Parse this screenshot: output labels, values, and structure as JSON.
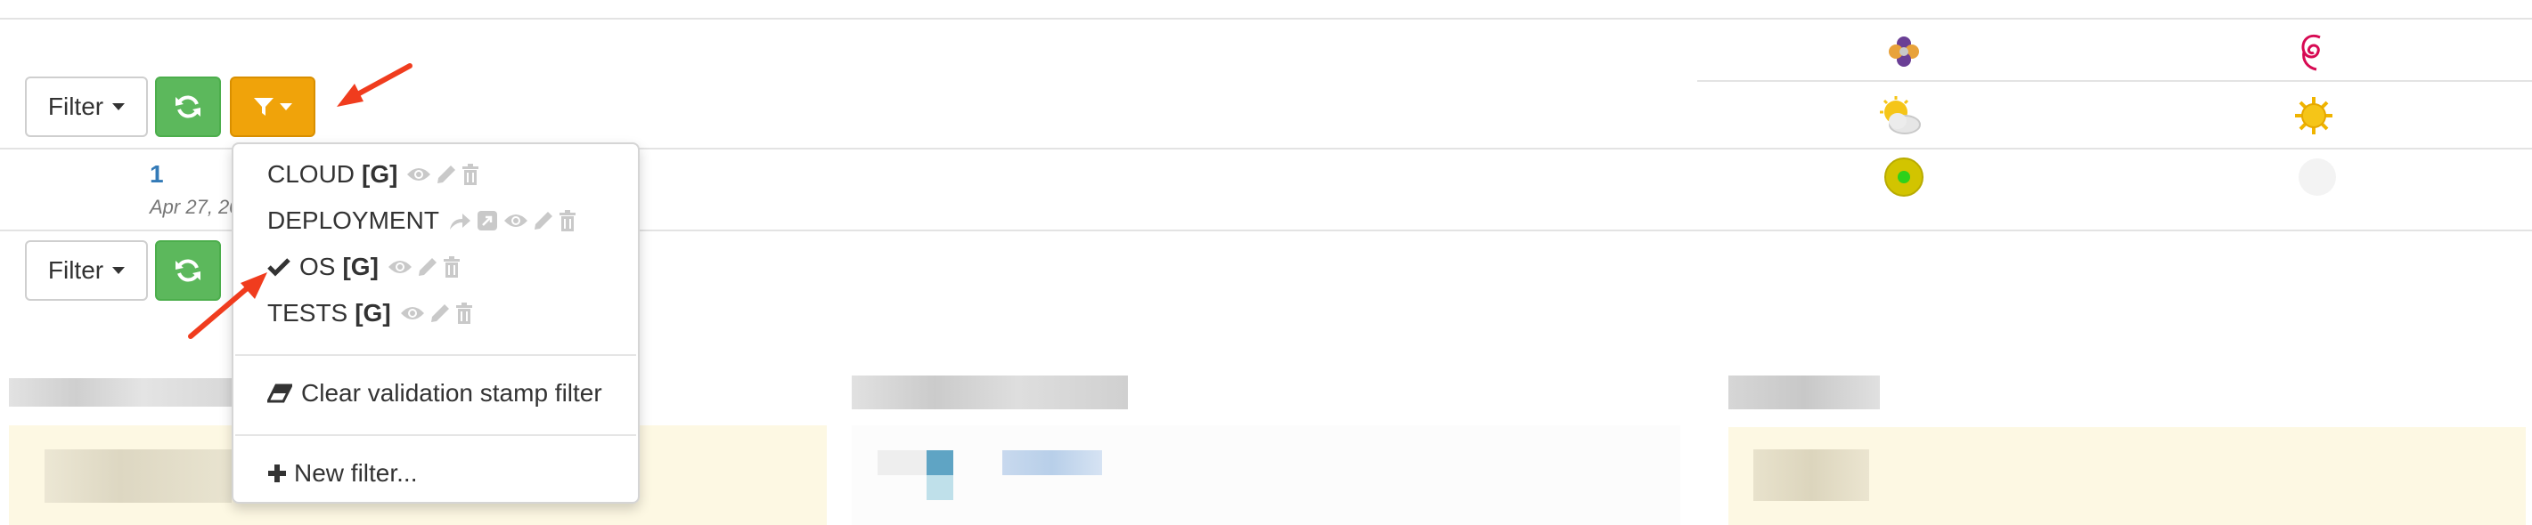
{
  "toolbar_top": {
    "filter_label": "Filter"
  },
  "toolbar_bottom": {
    "filter_label": "Filter"
  },
  "build": {
    "number": "1",
    "date": "Apr 27, 20"
  },
  "menu": {
    "items": [
      {
        "name": "CLOUD",
        "tag": "[G]"
      },
      {
        "name": "DEPLOYMENT",
        "tag": ""
      },
      {
        "name": "OS",
        "tag": "[G]",
        "checked": true
      },
      {
        "name": "TESTS",
        "tag": "[G]"
      }
    ],
    "clear_label": "Clear validation stamp filter",
    "new_label": "New filter..."
  },
  "colors": {
    "green": "#5cb85c",
    "orange": "#f0a30a",
    "arrow": "#f03c1e",
    "link": "#337ab7"
  },
  "icons": [
    "refresh-icon",
    "filter-icon",
    "eye-icon",
    "pencil-icon",
    "trash-icon",
    "share-icon",
    "external-icon",
    "check-icon",
    "eraser-icon",
    "plus-icon",
    "pinwheel-icon",
    "debian-swirl-icon",
    "cloudy-sun-icon",
    "sun-icon",
    "status-dot-icon"
  ]
}
